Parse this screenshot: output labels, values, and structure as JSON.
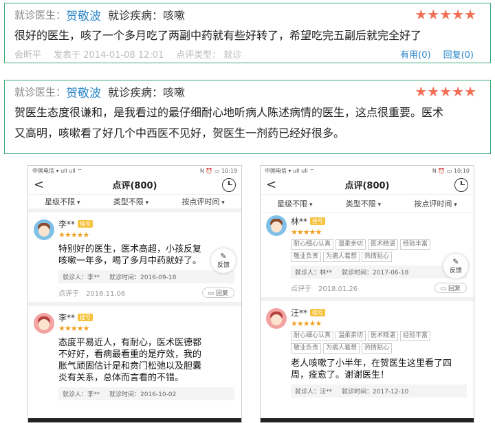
{
  "card1": {
    "doctor_label": "就诊医生：",
    "doctor_name": "贺敬波",
    "disease": "就诊疾病：咳嗽",
    "stars": "★★★★★",
    "content": "很好的医生，咳了一个多月吃了两副中药就有些好转了，希望吃完五副后就完全好了",
    "meta_author": "会昕平",
    "meta_date": "发表于 2014-01-08 12:01",
    "meta_type": "点评类型： 就诊",
    "useful": "有用(0)",
    "reply": "回复(0)"
  },
  "card2": {
    "doctor_label": "就诊医生：",
    "doctor_name": "贺敬波",
    "disease": "就诊疾病：咳嗽",
    "stars": "★★★★★",
    "content_line1": "贺医生态度很谦和，是我看过的最仔细耐心地听病人陈述病情的医生，这点很重要。医术",
    "content_line2": "又高明，咳嗽看了好几个中西医不见好，贺医生一剂药已经好很多。"
  },
  "phones": [
    {
      "status_left": "中国电信 ▾ ull ull ⌔",
      "status_right": "N ⏰ ▭ 10:19",
      "back": "<",
      "title": "点评(800)",
      "filters": [
        "星级不限",
        "类型不限",
        "按点评时间"
      ],
      "feedback": "反馈",
      "reviews": [
        {
          "avatar": "male",
          "name": "李**",
          "badge": "挂号",
          "stars": "★★★★★",
          "text": "特别好的医生，医术高超，小孩反复咳嗽一年多，喝了多月中药就好了。",
          "visitor": "就诊人：李**",
          "visit_time": "就诊时间：2016-09-18",
          "date": "点评于　2016.11.06",
          "reply": "回复",
          "tags": []
        },
        {
          "avatar": "female",
          "name": "李**",
          "badge": "挂号",
          "stars": "★★★★★",
          "text": "态度平易近人，有耐心，医术医德都不好好，看病最看重的是疗效，我的胀气顽固估计是和贲门松弛以及胆囊炎有关系，总体而言看的不错。",
          "visitor": "就诊人：李**",
          "visit_time": "就诊时间：2016-10-02",
          "date": "",
          "reply": "",
          "tags": []
        }
      ]
    },
    {
      "status_left": "中国电信 ▾ ull ull ⌔",
      "status_right": "N ⏰ ▭ 10:10",
      "back": "<",
      "title": "点评(800)",
      "filters": [
        "星级不限",
        "类型不限",
        "按点评时间"
      ],
      "feedback": "反馈",
      "reviews": [
        {
          "avatar": "male",
          "name": "林**",
          "badge": "挂号",
          "stars": "★★★★★",
          "text": "",
          "tags": [
            "耐心细心认真",
            "温柔亲切",
            "医术精湛",
            "经验丰富",
            "敬业负责",
            "为病人着想",
            "热情贴心"
          ],
          "visitor": "就诊人：林**",
          "visit_time": "就诊时间：2017-06-18",
          "date": "点评于　2018.01.26",
          "reply": "回复"
        },
        {
          "avatar": "female",
          "name": "汪**",
          "badge": "挂号",
          "stars": "★★★★★",
          "text": "老人咳嗽了小半年，在贺医生这里看了四周，痊愈了。谢谢医生！",
          "tags": [
            "耐心细心认真",
            "温柔亲切",
            "医术精湛",
            "经验丰富",
            "敬业负责",
            "为病人着想",
            "热情贴心"
          ],
          "visitor": "就诊人：汪**",
          "visit_time": "就诊时间：2017-12-10",
          "date": "",
          "reply": ""
        }
      ]
    }
  ]
}
